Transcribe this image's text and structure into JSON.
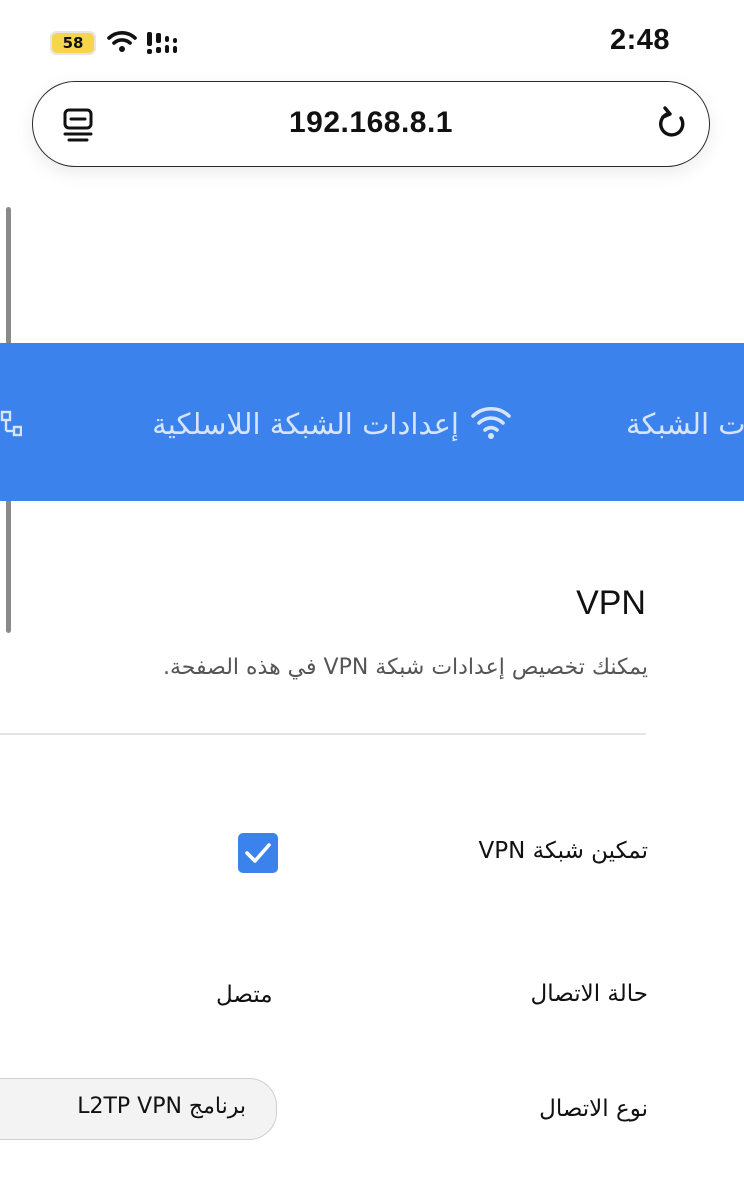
{
  "status_bar": {
    "time": "2:48",
    "battery": "58",
    "wifi_icon": "wifi-icon",
    "signal_icon": "signal-icon"
  },
  "browser": {
    "url": "192.168.8.1",
    "reader_icon": "reader-mode-icon",
    "reload_icon": "reload-icon"
  },
  "nav": {
    "items": [
      {
        "label": "",
        "icon": "network-topology-icon"
      },
      {
        "label": "إعدادات الشبكة اللاسلكية",
        "icon": "wifi-icon"
      },
      {
        "label": "ت الشبكة"
      }
    ]
  },
  "vpn": {
    "title": "VPN",
    "description": "يمكنك تخصيص إعدادات شبكة VPN في هذه الصفحة.",
    "enable_label": "تمكين شبكة VPN",
    "enable_checked": true,
    "status_label": "حالة الاتصال",
    "status_value": "متصل",
    "type_label": "نوع الاتصال",
    "type_value": "برنامج L2TP VPN"
  },
  "colors": {
    "accent": "#3c82ec",
    "battery": "#f5d64b",
    "nav_text": "#d7e5fb"
  }
}
